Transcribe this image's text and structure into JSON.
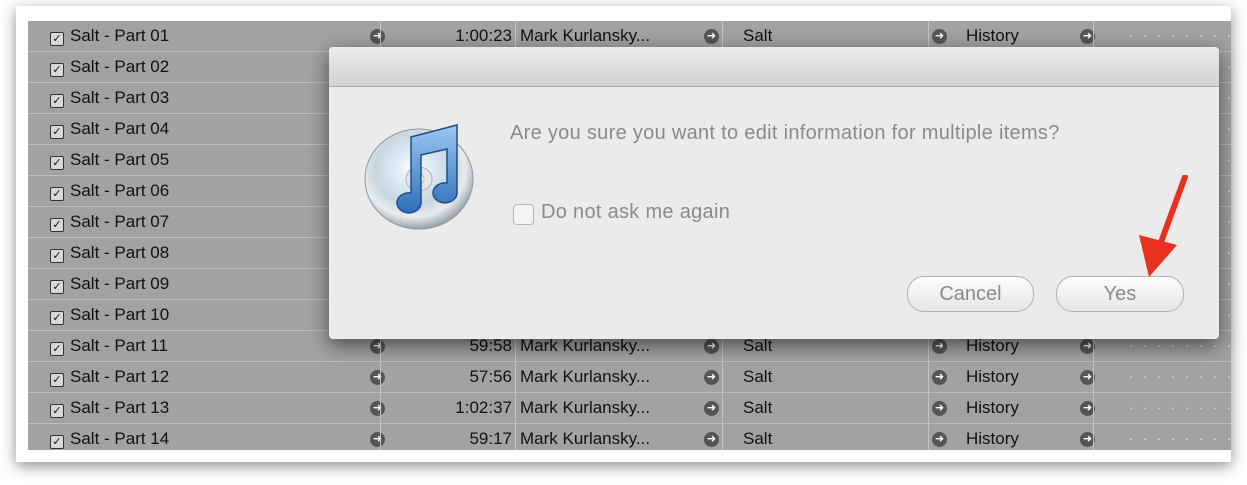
{
  "track_list": {
    "rows": [
      {
        "checked": true,
        "name": "Salt - Part 01",
        "time": "1:00:23",
        "artist": "Mark Kurlansky...",
        "album": "Salt",
        "genre": "History"
      },
      {
        "checked": true,
        "name": "Salt - Part 02",
        "time": "",
        "artist": "",
        "album": "",
        "genre": ""
      },
      {
        "checked": true,
        "name": "Salt - Part 03",
        "time": "",
        "artist": "",
        "album": "",
        "genre": ""
      },
      {
        "checked": true,
        "name": "Salt - Part 04",
        "time": "",
        "artist": "",
        "album": "",
        "genre": ""
      },
      {
        "checked": true,
        "name": "Salt - Part 05",
        "time": "",
        "artist": "",
        "album": "",
        "genre": ""
      },
      {
        "checked": true,
        "name": "Salt - Part 06",
        "time": "",
        "artist": "",
        "album": "",
        "genre": ""
      },
      {
        "checked": true,
        "name": "Salt - Part 07",
        "time": "",
        "artist": "",
        "album": "",
        "genre": ""
      },
      {
        "checked": true,
        "name": "Salt - Part 08",
        "time": "",
        "artist": "",
        "album": "",
        "genre": ""
      },
      {
        "checked": true,
        "name": "Salt - Part 09",
        "time": "",
        "artist": "",
        "album": "",
        "genre": ""
      },
      {
        "checked": true,
        "name": "Salt - Part 10",
        "time": "",
        "artist": "",
        "album": "",
        "genre": ""
      },
      {
        "checked": true,
        "name": "Salt - Part 11",
        "time": "59:58",
        "artist": "Mark Kurlansky...",
        "album": "Salt",
        "genre": "History"
      },
      {
        "checked": true,
        "name": "Salt - Part 12",
        "time": "57:56",
        "artist": "Mark Kurlansky...",
        "album": "Salt",
        "genre": "History"
      },
      {
        "checked": true,
        "name": "Salt - Part 13",
        "time": "1:02:37",
        "artist": "Mark Kurlansky...",
        "album": "Salt",
        "genre": "History"
      },
      {
        "checked": true,
        "name": "Salt - Part 14",
        "time": "59:17",
        "artist": "Mark Kurlansky...",
        "album": "Salt",
        "genre": "History"
      }
    ],
    "icons": {
      "row_arrow": "arrow-circle-icon",
      "checkbox": "checkbox-checked-icon"
    },
    "checkmark_glyph": "☑"
  },
  "dialog": {
    "message": "Are you sure you want to edit information for multiple items?",
    "checkbox_label": "Do not ask me again",
    "checkbox_checked": false,
    "cancel_label": "Cancel",
    "yes_label": "Yes",
    "icon": "itunes-cd-icon"
  },
  "annotation": {
    "icon": "red-arrow-pointer-icon",
    "color": "#e8321f"
  },
  "colors": {
    "list_background": "#a2a2a2",
    "dialog_background": "#ebebeb",
    "dialog_text": "#8a8a8a"
  }
}
